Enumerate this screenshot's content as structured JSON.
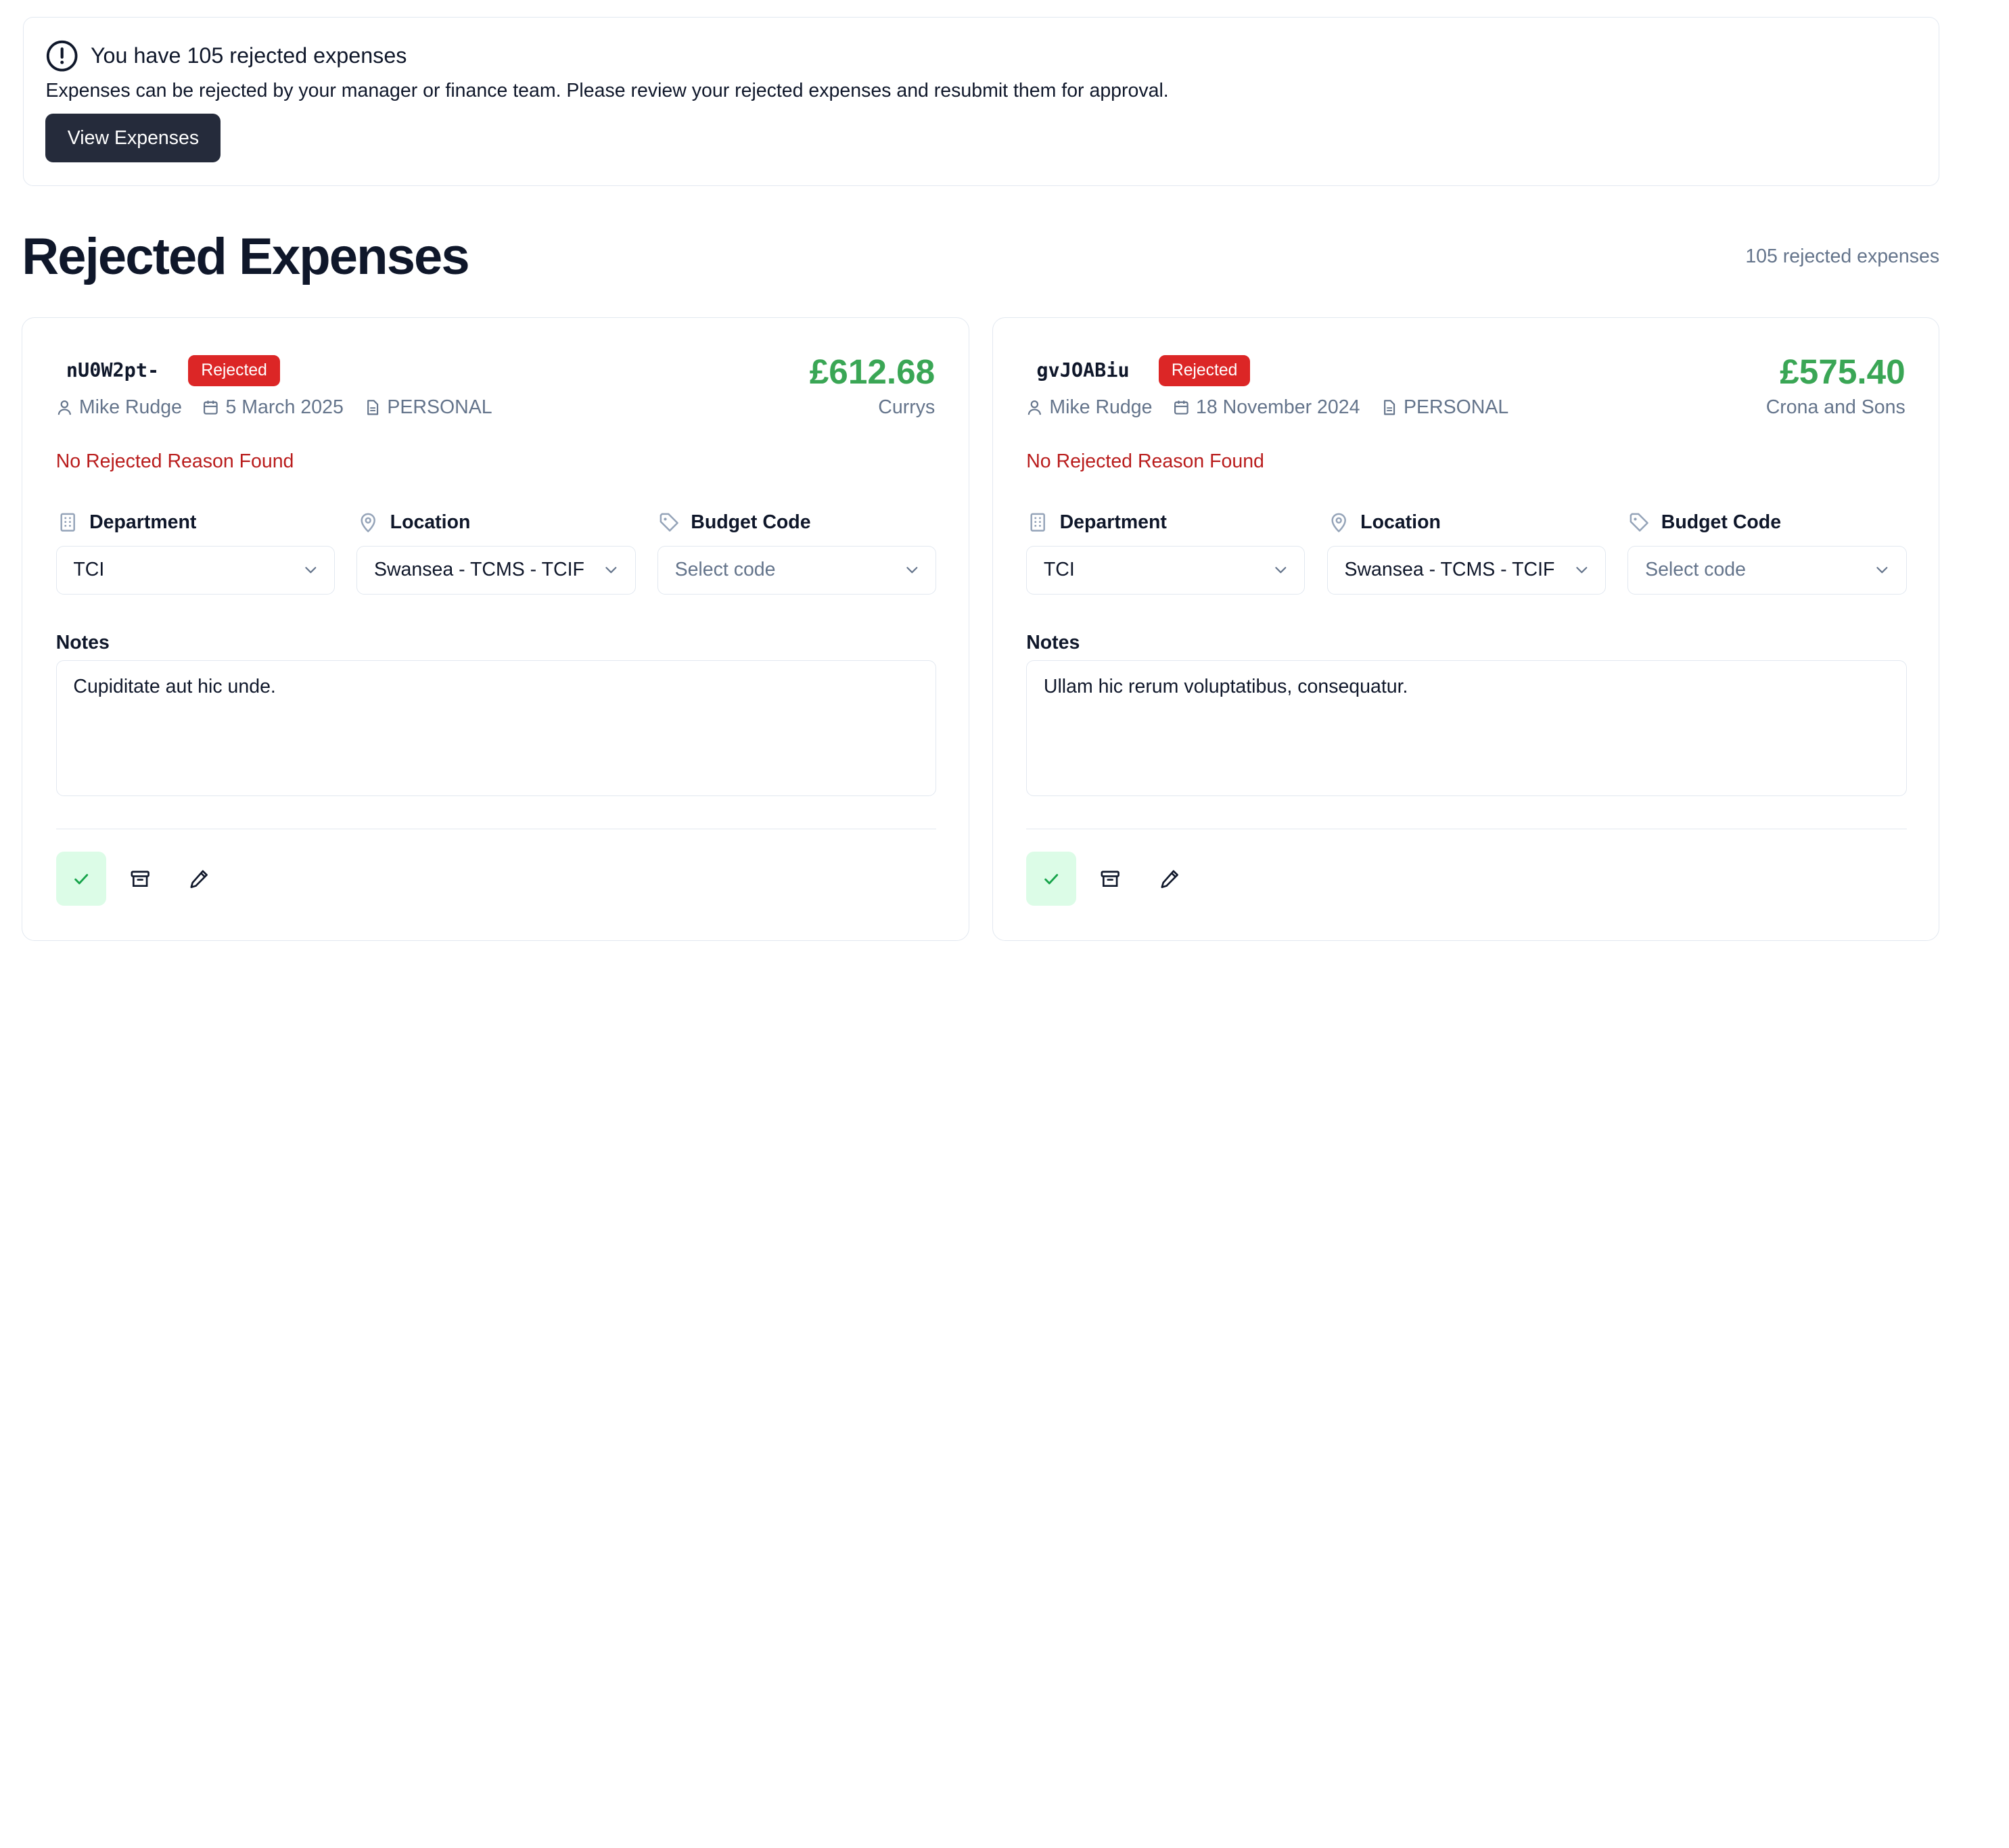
{
  "alert": {
    "icon": "alert-circle-icon",
    "title": "You have 105 rejected expenses",
    "description": "Expenses can be rejected by your manager or finance team. Please review your rejected expenses and resubmit them for approval.",
    "button_label": "View Expenses"
  },
  "page": {
    "title": "Rejected Expenses",
    "count_label": "105 rejected expenses"
  },
  "labels": {
    "department": "Department",
    "location": "Location",
    "budget_code": "Budget Code",
    "notes": "Notes"
  },
  "colors": {
    "amount": "#3aa655",
    "rejected_badge": "#dc2626",
    "reason_text": "#b91c1c",
    "primary_button": "#252b3b",
    "approve_bg": "#dcfce7"
  },
  "expenses": [
    {
      "id": "nU0W2pt-",
      "status": "Rejected",
      "amount": "£612.68",
      "vendor": "Currys",
      "user": "Mike Rudge",
      "date": "5 March 2025",
      "type": "PERSONAL",
      "reason": "No Rejected Reason Found",
      "department": "TCI",
      "location": "Swansea - TCMS - TCIF",
      "budget_code_placeholder": "Select code",
      "notes": "Cupiditate aut hic unde."
    },
    {
      "id": "gvJOABiu",
      "status": "Rejected",
      "amount": "£575.40",
      "vendor": "Crona and Sons",
      "user": "Mike Rudge",
      "date": "18 November 2024",
      "type": "PERSONAL",
      "reason": "No Rejected Reason Found",
      "department": "TCI",
      "location": "Swansea - TCMS - TCIF",
      "budget_code_placeholder": "Select code",
      "notes": "Ullam hic rerum voluptatibus, consequatur."
    }
  ]
}
